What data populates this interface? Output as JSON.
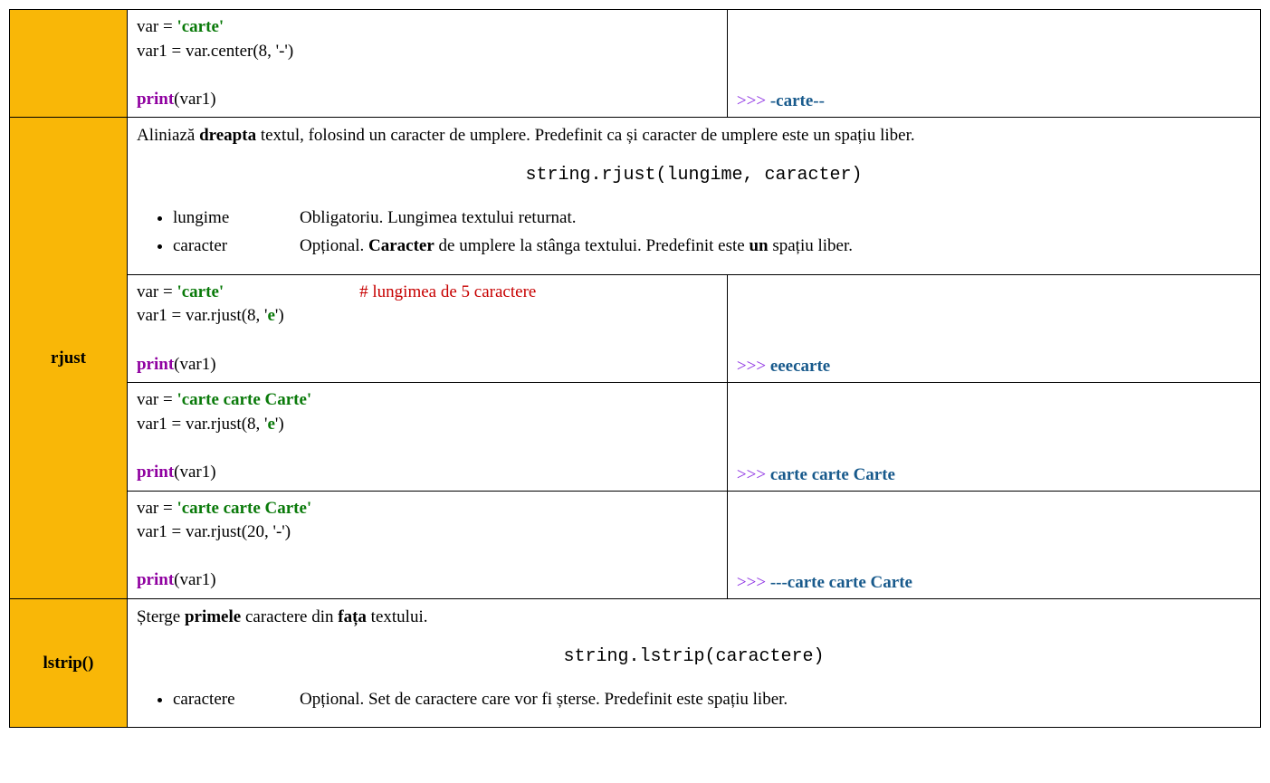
{
  "row0": {
    "code_l1a": "var = ",
    "code_l1b": "'carte'",
    "code_l2": "var1 = var.center(8, '-')",
    "code_p": "print",
    "code_pa": "(var1)",
    "out_p": ">>> ",
    "out_v": "-carte--"
  },
  "rjust": {
    "name": "rjust",
    "desc_a": "Aliniază ",
    "desc_b": "dreapta",
    "desc_c": " textul, folosind un caracter de umplere. Predefinit ca și caracter de umplere este un spațiu liber.",
    "syntax": "string.rjust(lungime, caracter)",
    "p1_name": "lungime",
    "p1_text": "Obligatoriu. Lungimea textului returnat.",
    "p2_name": "caracter",
    "p2_a": "Opțional. ",
    "p2_b": "Caracter",
    "p2_c": " de umplere la stânga textului. Predefinit este ",
    "p2_d": "un",
    "p2_e": " spațiu liber.",
    "ex1": {
      "l1a": "var = ",
      "l1b": "'carte'",
      "l1c": "# lungimea de 5 caractere",
      "l2a": "var1 = var.rjust(8, '",
      "l2b": "e",
      "l2c": "')",
      "p": "print",
      "pa": "(var1)",
      "out_p": ">>> ",
      "out_v": "eeecarte"
    },
    "ex2": {
      "l1a": "var = ",
      "l1b": "'carte carte Carte'",
      "l2a": "var1 = var.rjust(8, '",
      "l2b": "e",
      "l2c": "')",
      "p": "print",
      "pa": "(var1)",
      "out_p": ">>> ",
      "out_v": "carte carte Carte"
    },
    "ex3": {
      "l1a": "var = ",
      "l1b": "'carte carte Carte'",
      "l2": "var1 = var.rjust(20, '-')",
      "p": "print",
      "pa": "(var1)",
      "out_p": ">>> ",
      "out_v": "---carte carte Carte"
    }
  },
  "lstrip": {
    "name": "lstrip()",
    "desc_a": "Șterge ",
    "desc_b": "primele",
    "desc_c": " caractere din ",
    "desc_d": "fața",
    "desc_e": " textului.",
    "syntax": "string.lstrip(caractere)",
    "p1_name": "caractere",
    "p1_text": "Opțional. Set de caractere care vor fi șterse. Predefinit este spațiu liber."
  }
}
